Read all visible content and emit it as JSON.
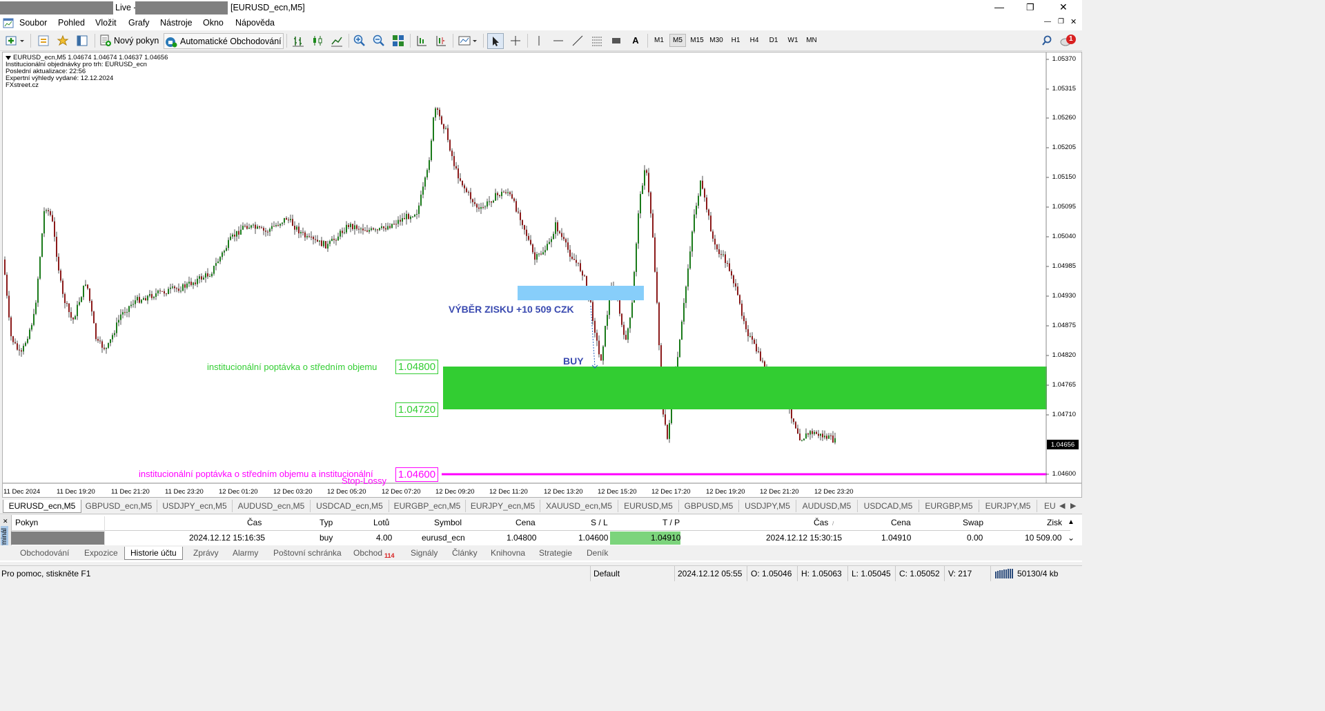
{
  "window": {
    "title_prefix": "Live -",
    "title_suffix": "[EURUSD_ecn,M5]",
    "min_glyph": "—",
    "max_glyph": "❐",
    "close_glyph": "✕"
  },
  "menu": [
    "Soubor",
    "Pohled",
    "Vložit",
    "Grafy",
    "Nástroje",
    "Okno",
    "Nápověda"
  ],
  "toolbar": {
    "new_order": "Nový pokyn",
    "auto_trading": "Automatické Obchodování",
    "text_tool": "A",
    "timeframes": [
      "M1",
      "M5",
      "M15",
      "M30",
      "H1",
      "H4",
      "D1",
      "W1",
      "MN"
    ],
    "active_timeframe": "M5",
    "notification_count": "1"
  },
  "chart": {
    "info": [
      "EURUSD_ecn,M5  1.04674 1.04674 1.04637 1.04656",
      "Institucionální objednávky pro trh: EURUSD_ecn",
      "Poslední aktualizace: 22:56",
      "Expertní výhledy vydané: 12.12.2024",
      "FXstreet.cz"
    ],
    "price_axis": [
      "1.05370",
      "1.05315",
      "1.05260",
      "1.05205",
      "1.05150",
      "1.05095",
      "1.05040",
      "1.04985",
      "1.04930",
      "1.04875",
      "1.04820",
      "1.04765",
      "1.04710",
      "1.04600"
    ],
    "current_price": "1.04656",
    "time_axis": [
      "11 Dec 2024",
      "11 Dec 19:20",
      "11 Dec 21:20",
      "11 Dec 23:20",
      "12 Dec 01:20",
      "12 Dec 03:20",
      "12 Dec 05:20",
      "12 Dec 07:20",
      "12 Dec 09:20",
      "12 Dec 11:20",
      "12 Dec 13:20",
      "12 Dec 15:20",
      "12 Dec 17:20",
      "12 Dec 19:20",
      "12 Dec 21:20",
      "12 Dec 23:20"
    ],
    "profit_text": "VÝBĚR ZISKU +10 509 CZK",
    "buy_text": "BUY",
    "zone_label": "institucionální poptávka o středním objemu",
    "zone_upper": "1.04800",
    "zone_lower": "1.04720",
    "stop_label_1": "institucionální poptávka o středním objemu a institucionální",
    "stop_label_2": "Stop-Lossy",
    "stop_level": "1.04600",
    "colors": {
      "bull": "#1a7a1a",
      "bear": "#8b1a1a",
      "zone": "#32cd32",
      "profit_zone": "#87cefa",
      "stop": "#ff00ff"
    }
  },
  "symbol_tabs": [
    "EURUSD_ecn,M5",
    "GBPUSD_ecn,M5",
    "USDJPY_ecn,M5",
    "AUDUSD_ecn,M5",
    "USDCAD_ecn,M5",
    "EURGBP_ecn,M5",
    "EURJPY_ecn,M5",
    "XAUUSD_ecn,M5",
    "EURUSD,M5",
    "GBPUSD,M5",
    "USDJPY,M5",
    "AUDUSD,M5",
    "USDCAD,M5",
    "EURGBP,M5",
    "EURJPY,M5",
    "EU"
  ],
  "terminal": {
    "side_label": "Terminál",
    "headers": [
      "Pokyn",
      "Čas",
      "Typ",
      "Lotů",
      "Symbol",
      "Cena",
      "S / L",
      "T / P",
      "Čas",
      "Cena",
      "Swap",
      "Zisk"
    ],
    "row": {
      "time_open": "2024.12.12 15:16:35",
      "type": "buy",
      "lots": "4.00",
      "symbol": "eurusd_ecn",
      "price_open": "1.04800",
      "sl": "1.04600",
      "tp": "1.04910",
      "time_close": "2024.12.12 15:30:15",
      "price_close": "1.04910",
      "swap": "0.00",
      "profit": "10 509.00"
    }
  },
  "bottom_tabs": [
    "Obchodování",
    "Expozice",
    "Historie účtu",
    "Zprávy",
    "Alarmy",
    "Poštovní schránka",
    "Obchod",
    "Signály",
    "Články",
    "Knihovna",
    "Strategie",
    "Deník"
  ],
  "obchod_badge": "114",
  "status": {
    "help": "Pro pomoc, stiskněte F1",
    "profile": "Default",
    "datetime": "2024.12.12 05:55",
    "open": "O: 1.05046",
    "high": "H: 1.05063",
    "low": "L: 1.05045",
    "close": "C: 1.05052",
    "volume": "V: 217",
    "traffic": "50130/4 kb"
  }
}
